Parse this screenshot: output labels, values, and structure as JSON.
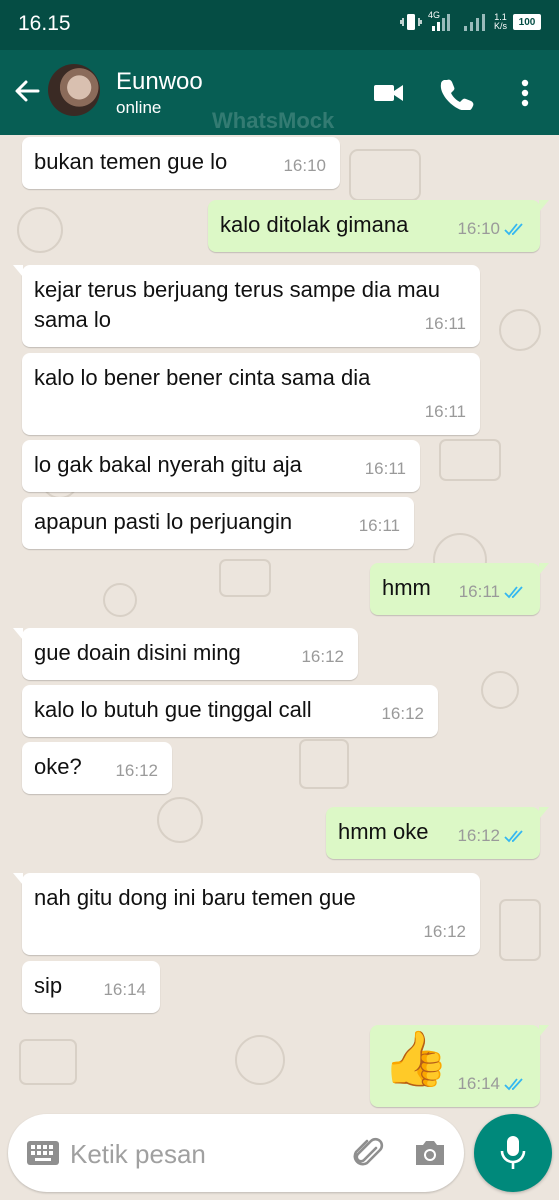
{
  "status_bar": {
    "time": "16.15",
    "network": "4G",
    "speed_value": "1.1",
    "speed_unit": "K/s",
    "battery": "100"
  },
  "header": {
    "contact_name": "Eunwoo",
    "contact_status": "online",
    "watermark": "WhatsMock",
    "icons": [
      "back-arrow-icon",
      "video-call-icon",
      "phone-icon",
      "more-vertical-icon"
    ]
  },
  "messages": [
    {
      "dir": "in",
      "text": "bukan temen gue lo",
      "time": "16:10"
    },
    {
      "dir": "out",
      "text": "kalo ditolak gimana",
      "time": "16:10"
    },
    {
      "dir": "in",
      "text": "kejar terus berjuang terus sampe dia mau sama lo",
      "time": "16:11"
    },
    {
      "dir": "in",
      "text": "kalo lo bener bener cinta sama dia",
      "time": "16:11"
    },
    {
      "dir": "in",
      "text": "lo gak bakal nyerah gitu aja",
      "time": "16:11"
    },
    {
      "dir": "in",
      "text": "apapun pasti lo perjuangin",
      "time": "16:11"
    },
    {
      "dir": "out",
      "text": "hmm",
      "time": "16:11"
    },
    {
      "dir": "in",
      "text": "gue doain disini ming",
      "time": "16:12"
    },
    {
      "dir": "in",
      "text": "kalo lo butuh gue tinggal call",
      "time": "16:12"
    },
    {
      "dir": "in",
      "text": "oke?",
      "time": "16:12"
    },
    {
      "dir": "out",
      "text": "hmm oke",
      "time": "16:12"
    },
    {
      "dir": "in",
      "text": "nah gitu dong ini baru temen gue",
      "time": "16:12"
    },
    {
      "dir": "in",
      "text": "sip",
      "time": "16:14"
    },
    {
      "dir": "out",
      "text": "👍",
      "time": "16:14"
    }
  ],
  "composer": {
    "placeholder": "Ketik pesan",
    "icons": [
      "keyboard-icon",
      "attach-icon",
      "camera-icon",
      "mic-icon"
    ]
  },
  "colors": {
    "status_bar": "#054D44",
    "header": "#075E54",
    "outgoing_bubble": "#DCF8C6",
    "incoming_bubble": "#FFFFFF",
    "read_ticks": "#34B7F1",
    "mic_button": "#00897B"
  }
}
